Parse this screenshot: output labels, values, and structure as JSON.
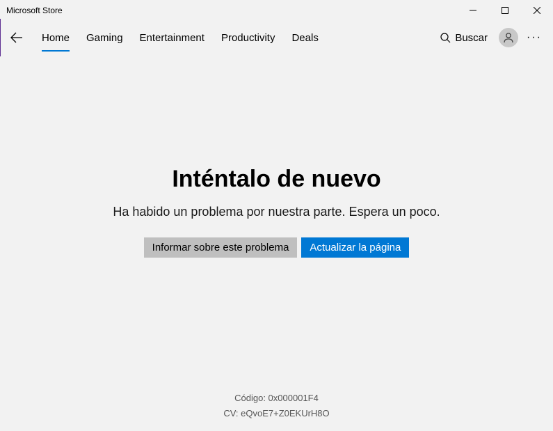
{
  "window": {
    "title": "Microsoft Store"
  },
  "nav": {
    "tabs": [
      {
        "label": "Home",
        "active": true
      },
      {
        "label": "Gaming",
        "active": false
      },
      {
        "label": "Entertainment",
        "active": false
      },
      {
        "label": "Productivity",
        "active": false
      },
      {
        "label": "Deals",
        "active": false
      }
    ],
    "search_label": "Buscar"
  },
  "error": {
    "title": "Inténtalo de nuevo",
    "message": "Ha habido un problema por nuestra parte. Espera un poco.",
    "report_label": "Informar sobre este problema",
    "refresh_label": "Actualizar la página"
  },
  "footer": {
    "code_label": "Código: 0x000001F4",
    "cv_label": "CV: eQvoE7+Z0EKUrH8O"
  }
}
